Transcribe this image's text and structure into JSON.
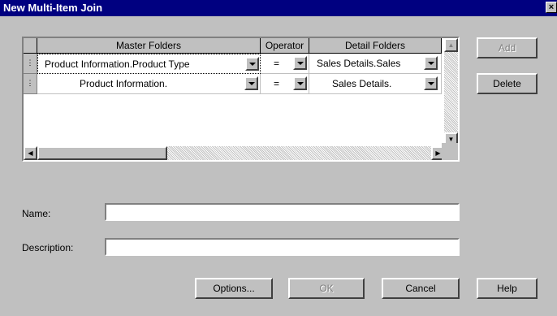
{
  "window": {
    "title": "New Multi-Item Join",
    "close_glyph": "×"
  },
  "grid": {
    "columns": {
      "master": "Master Folders",
      "operator": "Operator",
      "detail": "Detail Folders"
    },
    "rows": [
      {
        "selector": "⋮",
        "master": "Product Information.Product Type",
        "operator": "=",
        "detail": "Sales Details.Sales"
      },
      {
        "selector": "⋮",
        "master": "Product Information.",
        "operator": "=",
        "detail": "Sales Details."
      }
    ]
  },
  "buttons": {
    "add": "Add",
    "delete": "Delete",
    "options": "Options...",
    "ok": "OK",
    "cancel": "Cancel",
    "help": "Help"
  },
  "fields": {
    "name_label": "Name:",
    "name_value": "",
    "description_label": "Description:",
    "description_value": ""
  },
  "icons": {
    "scroll_up": "▲",
    "scroll_down": "▼",
    "scroll_left": "◀",
    "scroll_right": "▶"
  }
}
